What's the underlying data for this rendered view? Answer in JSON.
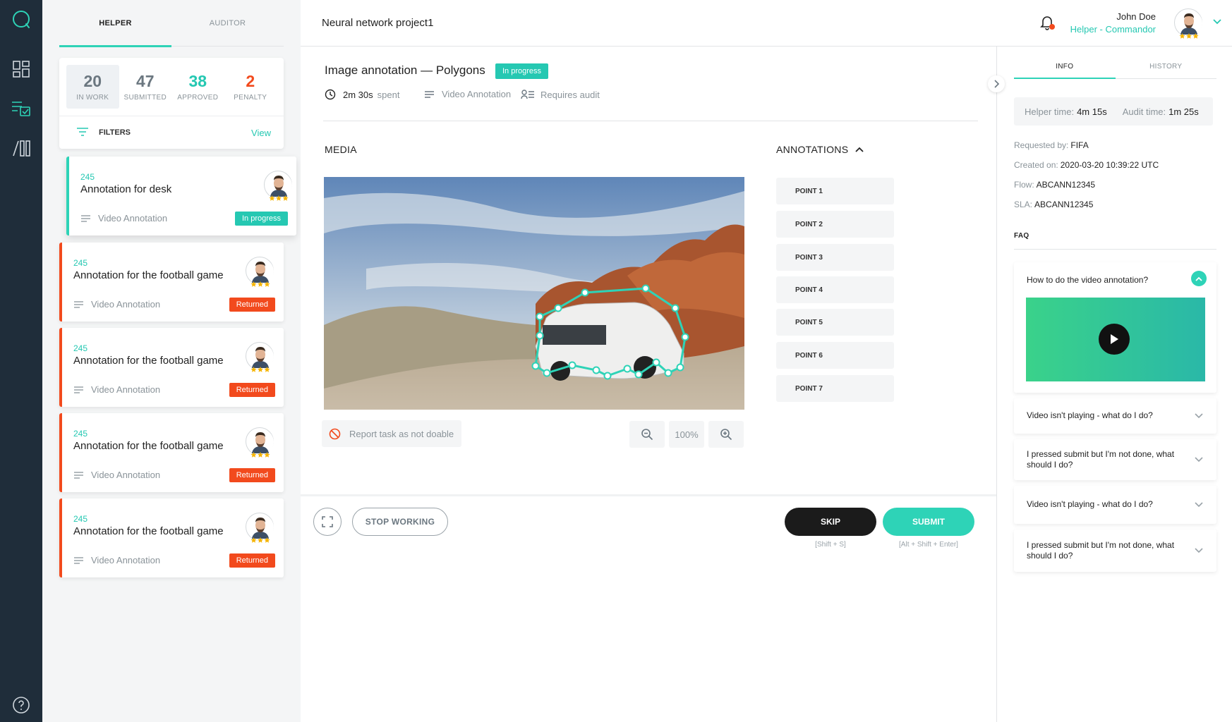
{
  "header": {
    "project_title": "Neural network project1",
    "user_name": "John Doe",
    "user_role": "Helper - Commandor"
  },
  "tabs": {
    "helper": "HELPER",
    "auditor": "AUDITOR"
  },
  "stats": [
    {
      "value": "20",
      "label": "IN WORK",
      "color": "#6b7780"
    },
    {
      "value": "47",
      "label": "SUBMITTED",
      "color": "#6b7780"
    },
    {
      "value": "38",
      "label": "APPROVED",
      "color": "#25c8b2"
    },
    {
      "value": "2",
      "label": "PENALTY",
      "color": "#f24a1d"
    }
  ],
  "filters": {
    "label": "FILTERS",
    "view": "View"
  },
  "tasks": [
    {
      "number": "245",
      "title": "Annotation for desk",
      "type": "Video Annotation",
      "status": "In progress",
      "status_color": "#25c8b2"
    },
    {
      "number": "245",
      "title": "Annotation for the football game",
      "type": "Video Annotation",
      "status": "Returned",
      "status_color": "#f24a1d"
    },
    {
      "number": "245",
      "title": "Annotation for the football game",
      "type": "Video Annotation",
      "status": "Returned",
      "status_color": "#f24a1d"
    },
    {
      "number": "245",
      "title": "Annotation for the football game",
      "type": "Video Annotation",
      "status": "Returned",
      "status_color": "#f24a1d"
    },
    {
      "number": "245",
      "title": "Annotation for the football game",
      "type": "Video Annotation",
      "status": "Returned",
      "status_color": "#f24a1d"
    }
  ],
  "task": {
    "title": "Image annotation — Polygons",
    "status": "In progress",
    "time_spent": "2m 30s",
    "time_suffix": "spent",
    "type": "Video Annotation",
    "audit": "Requires audit"
  },
  "media": {
    "label": "MEDIA",
    "annotations_label": "ANNOTATIONS",
    "points": [
      "POINT 1",
      "POINT 2",
      "POINT 3",
      "POINT 4",
      "POINT 5",
      "POINT 6",
      "POINT 7"
    ],
    "report": "Report task as not doable",
    "zoom": "100%"
  },
  "actions": {
    "stop": "STOP WORKING",
    "skip": "SKIP",
    "skip_hint": "[Shift + S]",
    "submit": "SUBMIT",
    "submit_hint": "[Alt + Shift + Enter]"
  },
  "info": {
    "tab_info": "INFO",
    "tab_history": "HISTORY",
    "helper_time_label": "Helper time:",
    "helper_time": "4m 15s",
    "audit_time_label": "Audit time:",
    "audit_time": "1m 25s",
    "requested_by_label": "Requested by:",
    "requested_by": "FIFA",
    "created_on_label": "Created on:",
    "created_on": "2020-03-20 10:39:22 UTC",
    "flow_label": "Flow:",
    "flow": "ABCANN12345",
    "sla_label": "SLA:",
    "sla": "ABCANN12345"
  },
  "faq": {
    "label": "FAQ",
    "items": [
      "How to do the video annotation?",
      "Video isn't playing - what do I do?",
      "I pressed submit but I'm not done, what should I do?",
      "Video isn't playing - what do I do?",
      "I pressed submit but I'm not done, what should I do?"
    ]
  },
  "colors": {
    "accent": "#2ed3b7",
    "danger": "#f24a1d",
    "rail": "#1f2d3a"
  }
}
